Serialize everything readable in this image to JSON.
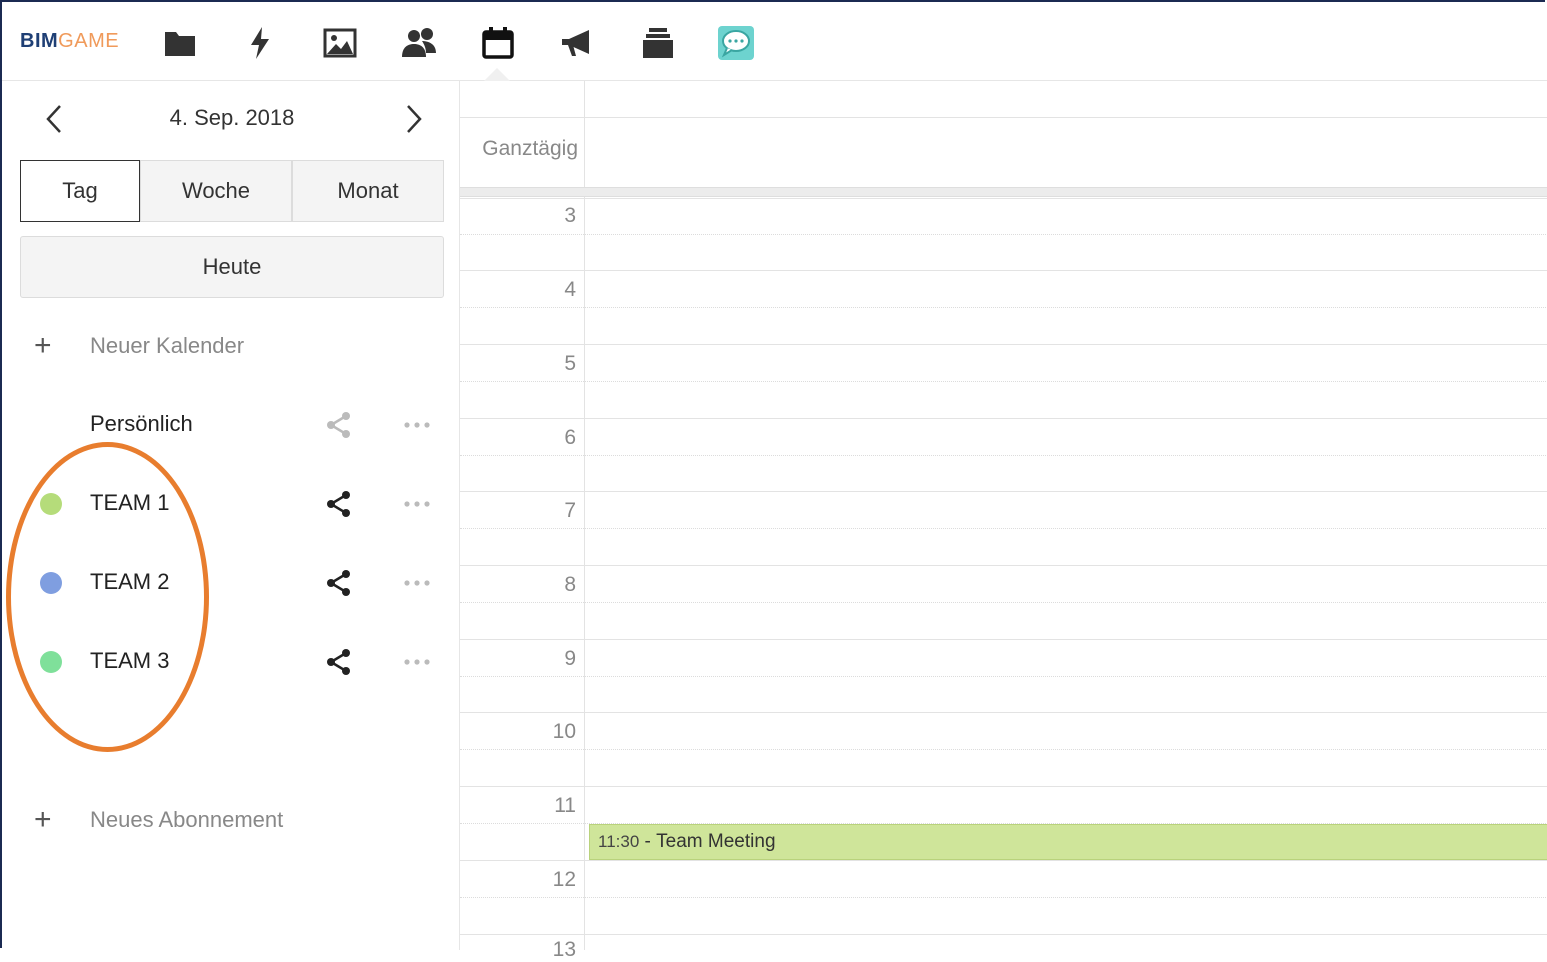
{
  "app": {
    "logo_part1": "BIM",
    "logo_part2": "GAME"
  },
  "nav": {
    "icons": [
      "folder-icon",
      "activity-icon",
      "gallery-icon",
      "contacts-icon",
      "calendar-icon",
      "announcement-icon",
      "deck-icon",
      "talk-icon"
    ],
    "active": "calendar-icon"
  },
  "sidebar": {
    "date": "4. Sep. 2018",
    "views": [
      {
        "label": "Tag",
        "active": true
      },
      {
        "label": "Woche",
        "active": false
      },
      {
        "label": "Monat",
        "active": false
      }
    ],
    "today_label": "Heute",
    "new_calendar_label": "Neuer Kalender",
    "calendars": [
      {
        "name": "Persönlich",
        "color": "",
        "shared": false
      },
      {
        "name": "TEAM 1",
        "color": "#b5dc7a",
        "shared": true
      },
      {
        "name": "TEAM 2",
        "color": "#7f9ee0",
        "shared": true
      },
      {
        "name": "TEAM 3",
        "color": "#7fe09a",
        "shared": true
      }
    ],
    "new_subscription_label": "Neues Abonnement"
  },
  "calendar": {
    "allday_label": "Ganztägig",
    "hours": [
      "3",
      "4",
      "5",
      "6",
      "7",
      "8",
      "9",
      "10",
      "11",
      "12",
      "13"
    ],
    "events": [
      {
        "time": "11:30",
        "separator": " - ",
        "title": "Team Meeting",
        "color": "#cfe59a"
      }
    ]
  },
  "colors": {
    "highlight": "#e87d2e",
    "frame": "#1b2a52"
  }
}
